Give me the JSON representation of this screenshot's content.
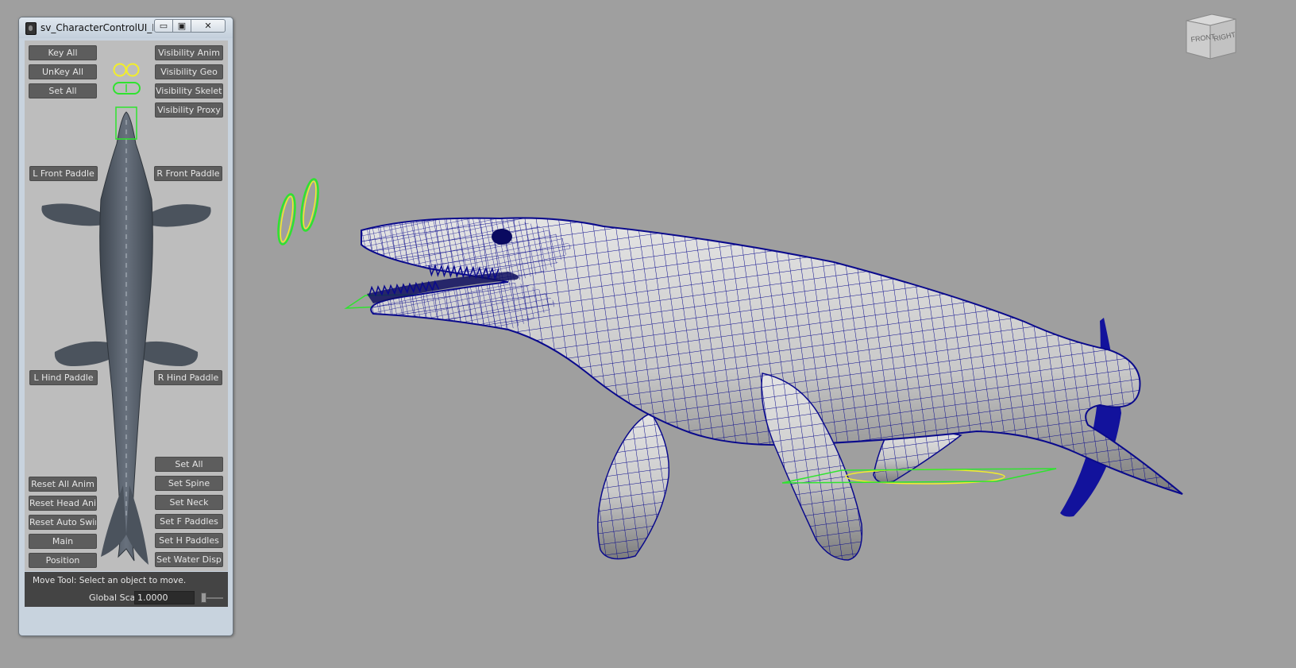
{
  "window": {
    "title": "sv_CharacterControlUI_M..."
  },
  "titlebar_buttons": {
    "minimize": "▭",
    "maximize": "▣",
    "close": "✕"
  },
  "buttons": {
    "key_all": "Key All",
    "unkey_all": "UnKey All",
    "set_all_top": "Set All",
    "visibility_anim": "Visibility Anim",
    "visibility_geo": "Visibility Geo",
    "visibility_skeleton": "Visibility Skeleton",
    "visibility_proxy": "Visibility Proxy",
    "l_front_paddle": "L Front Paddle",
    "r_front_paddle": "R Front Paddle",
    "l_hind_paddle": "L Hind Paddle",
    "r_hind_paddle": "R Hind Paddle",
    "set_all_bottom": "Set All",
    "set_spine": "Set Spine",
    "set_neck": "Set Neck",
    "set_f_paddles": "Set F Paddles",
    "set_h_paddles": "Set H Paddles",
    "set_water_disp": "Set Water Disp",
    "reset_all_anim": "Reset All Anim",
    "reset_head_anim": "Reset Head Anim",
    "reset_auto_swim": "Reset Auto Swim",
    "main": "Main",
    "position": "Position"
  },
  "help_line": "Move Tool: Select an object to move.",
  "global_scale": {
    "label": "Global Scale",
    "value": "1.0000",
    "slider_level": 0
  },
  "viewcube": {
    "front": "FRONT",
    "right": "RIGHT"
  },
  "colors": {
    "viewport_bg": "#9f9f9f",
    "wireframe": "#0a0a8c",
    "control_green": "#2fe32f",
    "control_yellow": "#f2ee2a",
    "button_bg": "#5d5d5d"
  },
  "icons": {
    "app": "maya-window-icon",
    "eye_controls": "eyes-control-icon",
    "jaw_control": "jaw-control-icon"
  }
}
